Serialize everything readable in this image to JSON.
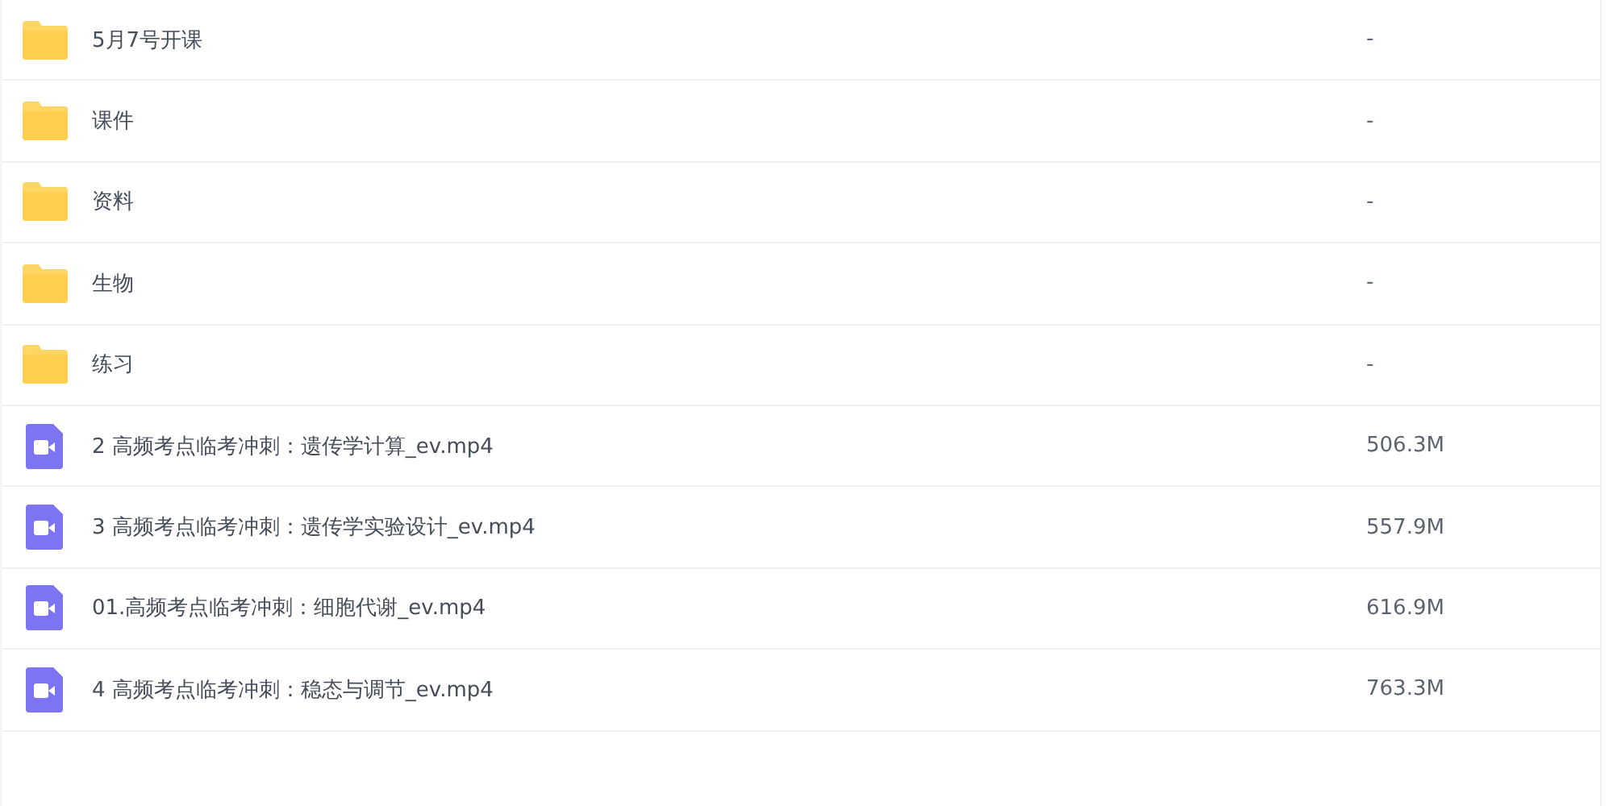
{
  "files": [
    {
      "kind": "folder",
      "name": "5月7号开课",
      "size": "-"
    },
    {
      "kind": "folder",
      "name": "课件",
      "size": "-"
    },
    {
      "kind": "folder",
      "name": "资料",
      "size": "-"
    },
    {
      "kind": "folder",
      "name": "生物",
      "size": "-"
    },
    {
      "kind": "folder",
      "name": "练习",
      "size": "-"
    },
    {
      "kind": "video",
      "name": "2 高频考点临考冲刺：遗传学计算_ev.mp4",
      "size": "506.3M"
    },
    {
      "kind": "video",
      "name": "3 高频考点临考冲刺：遗传学实验设计_ev.mp4",
      "size": "557.9M"
    },
    {
      "kind": "video",
      "name": "01.高频考点临考冲刺：细胞代谢_ev.mp4",
      "size": "616.9M"
    },
    {
      "kind": "video",
      "name": "4 高频考点临考冲刺：稳态与调节_ev.mp4",
      "size": "763.3M"
    }
  ]
}
